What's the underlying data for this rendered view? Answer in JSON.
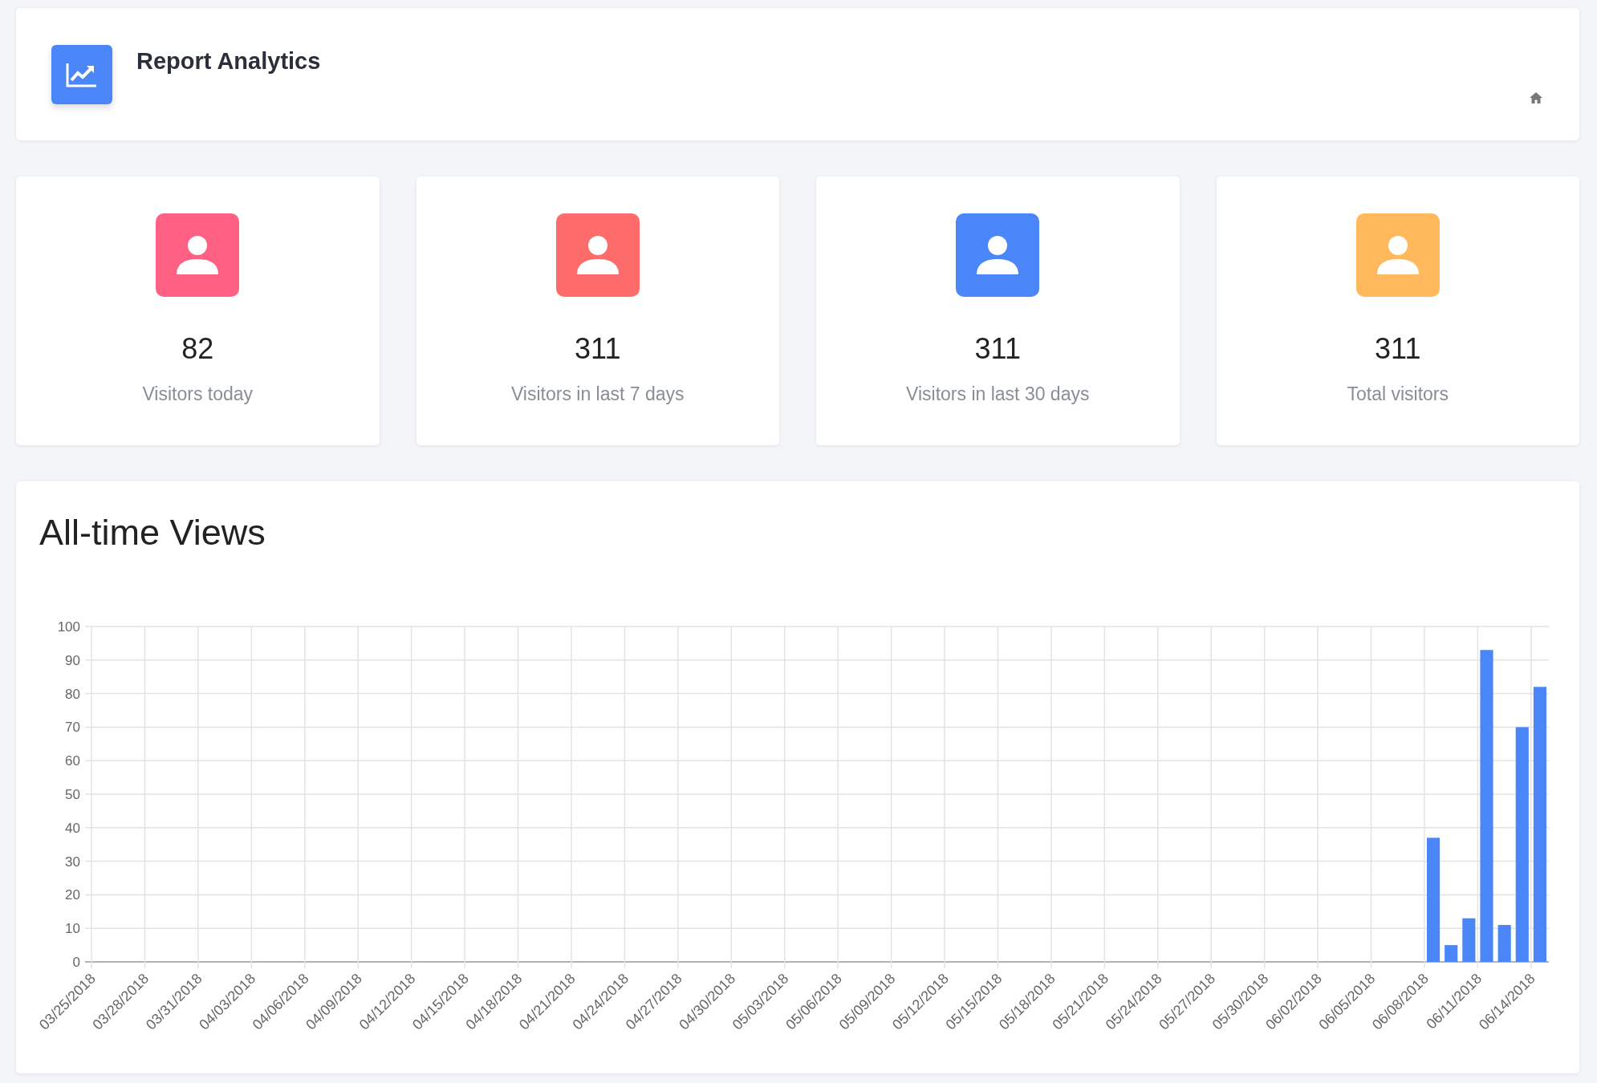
{
  "header": {
    "title": "Report Analytics"
  },
  "stats": [
    {
      "value": "82",
      "label": "Visitors today",
      "color": "#fe6184"
    },
    {
      "value": "311",
      "label": "Visitors in last 7 days",
      "color": "#fe6b6b"
    },
    {
      "value": "311",
      "label": "Visitors in last 30 days",
      "color": "#4a86f7"
    },
    {
      "value": "311",
      "label": "Total visitors",
      "color": "#ffb85c"
    }
  ],
  "views": {
    "title": "All-time Views",
    "chart_data": {
      "type": "bar",
      "grid": true,
      "yticks": [
        0,
        10,
        20,
        30,
        40,
        50,
        60,
        70,
        80,
        90,
        100
      ],
      "ylim": [
        0,
        100
      ],
      "categories": [
        "03/25/2018",
        null,
        null,
        "03/28/2018",
        null,
        null,
        "03/31/2018",
        null,
        null,
        "04/03/2018",
        null,
        null,
        "04/06/2018",
        null,
        null,
        "04/09/2018",
        null,
        null,
        "04/12/2018",
        null,
        null,
        "04/15/2018",
        null,
        null,
        "04/18/2018",
        null,
        null,
        "04/21/2018",
        null,
        null,
        "04/24/2018",
        null,
        null,
        "04/27/2018",
        null,
        null,
        "04/30/2018",
        null,
        null,
        "05/03/2018",
        null,
        null,
        "05/06/2018",
        null,
        null,
        "05/09/2018",
        null,
        null,
        "05/12/2018",
        null,
        null,
        "05/15/2018",
        null,
        null,
        "05/18/2018",
        null,
        null,
        "05/21/2018",
        null,
        null,
        "05/24/2018",
        null,
        null,
        "05/27/2018",
        null,
        null,
        "05/30/2018",
        null,
        null,
        "06/02/2018",
        null,
        null,
        "06/05/2018",
        null,
        null,
        "06/08/2018",
        null,
        null,
        "06/11/2018",
        null,
        null,
        "06/14/2018"
      ],
      "series": [
        {
          "color": "#4a86f7",
          "values": [
            0,
            0,
            0,
            0,
            0,
            0,
            0,
            0,
            0,
            0,
            0,
            0,
            0,
            0,
            0,
            0,
            0,
            0,
            0,
            0,
            0,
            0,
            0,
            0,
            0,
            0,
            0,
            0,
            0,
            0,
            0,
            0,
            0,
            0,
            0,
            0,
            0,
            0,
            0,
            0,
            0,
            0,
            0,
            0,
            0,
            0,
            0,
            0,
            0,
            0,
            0,
            0,
            0,
            0,
            0,
            0,
            0,
            0,
            0,
            0,
            0,
            0,
            0,
            0,
            0,
            0,
            0,
            0,
            0,
            0,
            0,
            0,
            0,
            0,
            0,
            37,
            5,
            13,
            93,
            11,
            70,
            82
          ]
        }
      ]
    }
  }
}
